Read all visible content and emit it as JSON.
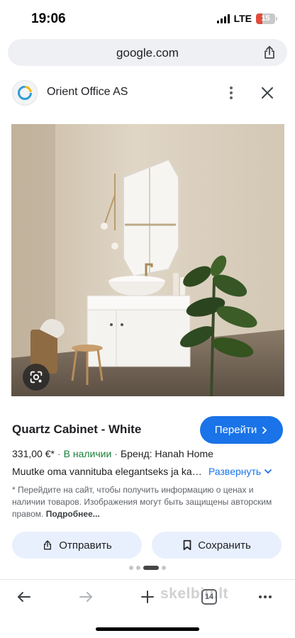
{
  "status_bar": {
    "time": "19:06",
    "network": "LTE",
    "battery": "15",
    "battery_color": "#e04b3c"
  },
  "browser": {
    "url": "google.com",
    "tab_count": "14"
  },
  "site": {
    "name": "Orient Office AS"
  },
  "product": {
    "title": "Quartz Cabinet - White",
    "visit_label": "Перейти",
    "price": "331,00 €*",
    "availability": "В наличии",
    "brand": "Бренд: Hanah Home",
    "description": "Muutke oma vannituba elegantseks ja kaasaegseks",
    "expand_label": "Развернуть",
    "disclaimer": "* Перейдите на сайт, чтобы получить информацию о ценах и наличии товаров. Изображения могут быть защищены авторским правом.",
    "disclaimer_more": "Подробнее..."
  },
  "actions": {
    "share_label": "Отправить",
    "save_label": "Сохранить"
  },
  "pager": {
    "total": 4,
    "active_index": 2
  },
  "watermark": "skelbiu.lt",
  "colors": {
    "accent": "#1a73e8",
    "in_stock": "#188038",
    "action_bg": "#e8f0fe"
  },
  "icons": [
    "signal-icon",
    "battery-icon",
    "share-icon",
    "site-logo-icon",
    "more-vert-icon",
    "close-icon",
    "google-lens-icon",
    "chevron-right-icon",
    "chevron-down-icon",
    "bookmark-icon",
    "back-arrow-icon",
    "forward-arrow-icon",
    "plus-icon",
    "tabs-icon",
    "more-horiz-icon"
  ]
}
